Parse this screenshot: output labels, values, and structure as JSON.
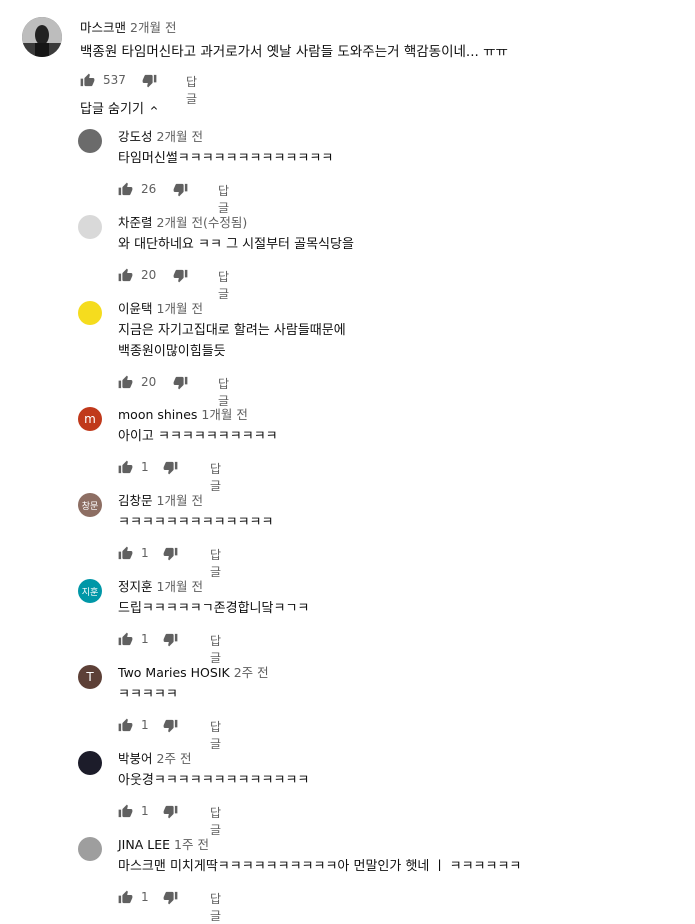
{
  "colors": {
    "background": "#ffffff",
    "text": "#0f0f0f",
    "secondary": "#606060"
  },
  "top_comment": {
    "author": "마스크맨",
    "time": "2개월 전",
    "text": "백종원 타임머신타고 과거로가서 옛날 사람들 도와주는거 핵감동이네... ㅠㅠ",
    "likes": "537",
    "reply_label": "답글"
  },
  "toggle_label": "답글 숨기기",
  "replies": [
    {
      "author": "강도성",
      "time": "2개월 전",
      "lines": [
        "타임머신썰ㅋㅋㅋㅋㅋㅋㅋㅋㅋㅋㅋㅋㅋ"
      ],
      "likes": "26",
      "reply_label": "답글",
      "avatar_text": "",
      "avatar_color": "#6b6b6b"
    },
    {
      "author": "차준렬",
      "time": "2개월 전(수정됨)",
      "lines": [
        "와 대단하네요  ㅋㅋ 그 시절부터 골목식당을"
      ],
      "likes": "20",
      "reply_label": "답글",
      "avatar_text": "",
      "avatar_color": "#d9d9d9"
    },
    {
      "author": "이윤택",
      "time": "1개월 전",
      "lines": [
        "지금은 자기고집대로 할려는 사람들때문에",
        "백종원이많이힘들듯"
      ],
      "likes": "20",
      "reply_label": "답글",
      "avatar_text": "",
      "avatar_color": "#f5dc1e"
    },
    {
      "author": "moon shines",
      "time": "1개월 전",
      "lines": [
        "아이고 ㅋㅋㅋㅋㅋㅋㅋㅋㅋㅋ"
      ],
      "likes": "1",
      "reply_label": "답글",
      "avatar_text": "m",
      "avatar_color": "#c0391b"
    },
    {
      "author": "김창문",
      "time": "1개월 전",
      "lines": [
        "ㅋㅋㅋㅋㅋㅋㅋㅋㅋㅋㅋㅋㅋ"
      ],
      "likes": "1",
      "reply_label": "답글",
      "avatar_text": "창문",
      "avatar_color": "#8d6e63"
    },
    {
      "author": "정지훈",
      "time": "1개월 전",
      "lines": [
        "드립ㅋㅋㅋㅋㅋㄱ존경합니닼ㅋㄱㅋ"
      ],
      "likes": "1",
      "reply_label": "답글",
      "avatar_text": "지훈",
      "avatar_color": "#0097a7"
    },
    {
      "author": "Two Maries HOSIK",
      "time": "2주 전",
      "lines": [
        "ㅋㅋㅋㅋㅋ"
      ],
      "likes": "1",
      "reply_label": "답글",
      "avatar_text": "T",
      "avatar_color": "#5d4037"
    },
    {
      "author": "박붕어",
      "time": "2주 전",
      "lines": [
        "아웃경ㅋㅋㅋㅋㅋㅋㅋㅋㅋㅋㅋㅋㅋ"
      ],
      "likes": "1",
      "reply_label": "답글",
      "avatar_text": "",
      "avatar_color": "#1c1c2a"
    },
    {
      "author": "JINA LEE",
      "time": "1주 전",
      "lines": [
        "마스크맨 미치게딱ㅋㅋㅋㅋㅋㅋㅋㅋㅋㅋ아 먼말인가 햇네 ㅣ ㅋㅋㅋㅋㅋㅋ"
      ],
      "likes": "1",
      "reply_label": "답글",
      "avatar_text": "",
      "avatar_color": "#9e9e9e"
    }
  ]
}
